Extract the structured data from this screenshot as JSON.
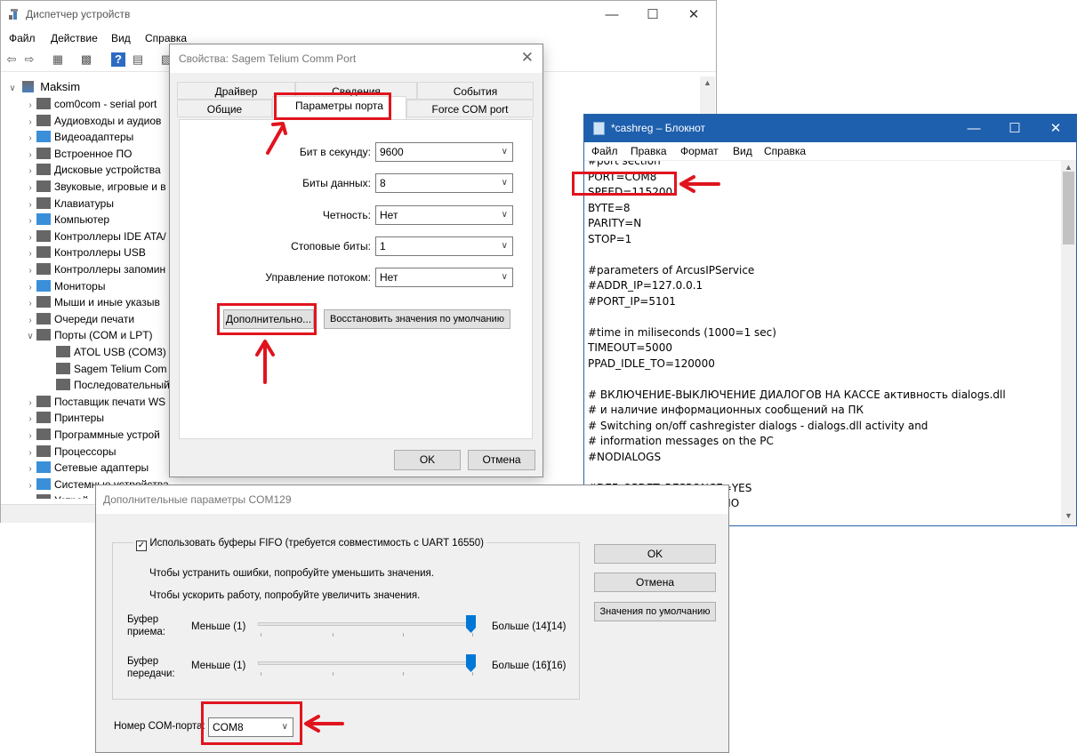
{
  "colors": {
    "highlight": "#e0141e",
    "notepad_title": "#1e5fae",
    "slider": "#0078d7"
  },
  "device_manager": {
    "title": "Диспетчер устройств",
    "menu": [
      "Файл",
      "Действие",
      "Вид",
      "Справка"
    ],
    "root": "Maksim",
    "tree": [
      {
        "label": "com0com - serial port",
        "icon": "port-icon"
      },
      {
        "label": "Аудиовходы и аудиов",
        "icon": "audio-icon"
      },
      {
        "label": "Видеоадаптеры",
        "icon": "display-adapter-icon"
      },
      {
        "label": "Встроенное ПО",
        "icon": "firmware-icon"
      },
      {
        "label": "Дисковые устройства",
        "icon": "disk-icon"
      },
      {
        "label": "Звуковые, игровые и в",
        "icon": "sound-icon"
      },
      {
        "label": "Клавиатуры",
        "icon": "keyboard-icon"
      },
      {
        "label": "Компьютер",
        "icon": "computer-icon"
      },
      {
        "label": "Контроллеры IDE ATA/",
        "icon": "ide-icon"
      },
      {
        "label": "Контроллеры USB",
        "icon": "usb-icon"
      },
      {
        "label": "Контроллеры запомин",
        "icon": "storage-icon"
      },
      {
        "label": "Мониторы",
        "icon": "monitor-icon"
      },
      {
        "label": "Мыши и иные указыв",
        "icon": "mouse-icon"
      },
      {
        "label": "Очереди печати",
        "icon": "print-queue-icon"
      },
      {
        "label": "Порты (COM и LPT)",
        "icon": "port-icon"
      },
      {
        "label": "ATOL USB (COM3)",
        "icon": "port-icon"
      },
      {
        "label": "Sagem Telium Com",
        "icon": "port-icon"
      },
      {
        "label": "Последовательный",
        "icon": "port-icon"
      },
      {
        "label": "Поставщик печати WS",
        "icon": "printer-icon"
      },
      {
        "label": "Принтеры",
        "icon": "printer-icon"
      },
      {
        "label": "Программные устрой",
        "icon": "software-icon"
      },
      {
        "label": "Процессоры",
        "icon": "cpu-icon"
      },
      {
        "label": "Сетевые адаптеры",
        "icon": "network-icon"
      },
      {
        "label": "Системные устройства",
        "icon": "system-icon"
      },
      {
        "label": "Устрой",
        "icon": "device-icon"
      }
    ]
  },
  "props": {
    "title": "Свойства: Sagem Telium Comm Port",
    "tabs_back": [
      "Драйвер",
      "Сведения",
      "События"
    ],
    "tabs_front": [
      "Общие",
      "Параметры порта",
      "Force COM port"
    ],
    "fields": [
      {
        "label": "Бит в секунду:",
        "value": "9600"
      },
      {
        "label": "Биты данных:",
        "value": "8"
      },
      {
        "label": "Четность:",
        "value": "Нет"
      },
      {
        "label": "Стоповые биты:",
        "value": "1"
      },
      {
        "label": "Управление потоком:",
        "value": "Нет"
      }
    ],
    "advanced_button": "Дополнительно...",
    "restore_button": "Восстановить значения по умолчанию",
    "ok": "OK",
    "cancel": "Отмена"
  },
  "notepad": {
    "title": "*cashreg – Блокнот",
    "menu": [
      "Файл",
      "Правка",
      "Формат",
      "Вид",
      "Справка"
    ],
    "lines": [
      "#port section",
      "PORT=COM8",
      "SPEED=115200",
      "BYTE=8",
      "PARITY=N",
      "STOP=1",
      "",
      "#parameters of ArcusIPService",
      "#ADDR_IP=127.0.0.1",
      "#PORT_IP=5101",
      "",
      "#time in miliseconds (1000=1 sec)",
      "TIMEOUT=5000",
      "PPAD_IDLE_TO=120000",
      "",
      "# ВКЛЮЧЕНИЕ-ВЫКЛЮЧЕНИЕ ДИАЛОГОВ НА КАССЕ активность dialogs.dll",
      "# и наличие информационных сообщений на ПК",
      "# Switching on/off cashregister dialogs - dialogs.dll activity and",
      "# information messages on the PC",
      "#NODIALOGS",
      "",
      "#DEF_OPDET_RESPONCE=YES",
      "DEF_OPDET_RESPONCE=NO"
    ]
  },
  "advanced": {
    "title": "Дополнительные параметры COM129",
    "fifo_label": "Использовать буферы FIFO (требуется совместимость с UART 16550)",
    "fifo_checked": true,
    "hint1": "Чтобы устранить ошибки, попробуйте уменьшить значения.",
    "hint2": "Чтобы ускорить работу, попробуйте увеличить значения.",
    "rx": {
      "label1": "Буфер",
      "label2": "приема:",
      "min": "Меньше (1)",
      "max": "Больше (14)",
      "value": "(14)",
      "level": 1.0
    },
    "tx": {
      "label1": "Буфер",
      "label2": "передачи:",
      "min": "Меньше (1)",
      "max": "Больше (16)",
      "value": "(16)",
      "level": 1.0
    },
    "com_label": "Номер COM-порта:",
    "com_value": "COM8",
    "ok": "OK",
    "cancel": "Отмена",
    "defaults": "Значения по умолчанию"
  }
}
